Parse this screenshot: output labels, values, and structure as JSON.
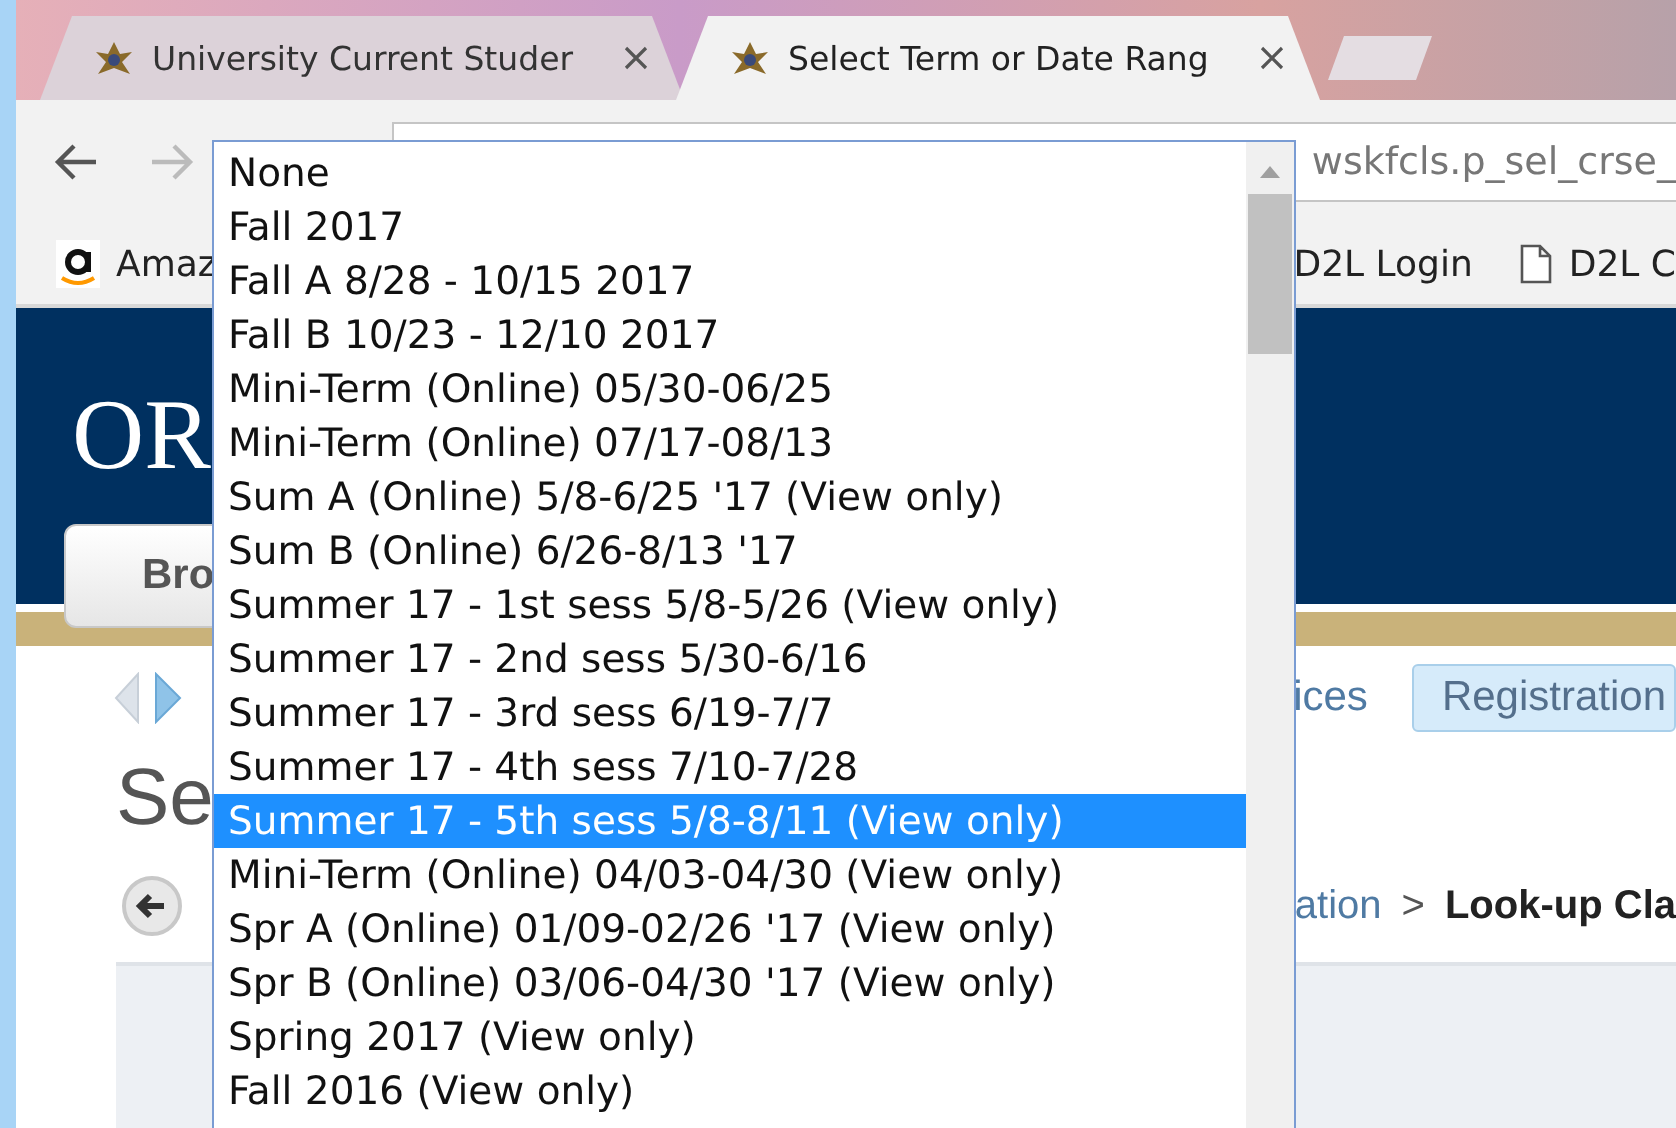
{
  "browser": {
    "tabs": [
      {
        "title": "University Current Studer",
        "selected": false
      },
      {
        "title": "Select Term or Date Rang",
        "selected": true
      }
    ],
    "address": "wskfcls.p_sel_crse_",
    "bookmarks": [
      {
        "label": "Amaz",
        "kind": "amazon"
      },
      {
        "label": "D2L Login",
        "kind": "plain"
      },
      {
        "label": "D2L C",
        "kind": "page"
      }
    ]
  },
  "page": {
    "logo": "OR",
    "button": "Bro",
    "nav": [
      {
        "label": "ices",
        "selected": false
      },
      {
        "label": "Registration",
        "selected": true
      }
    ],
    "title": "Se",
    "breadcrumb": [
      {
        "label": "ation",
        "current": false
      },
      {
        "label": ">",
        "current": false
      },
      {
        "label": "Look-up Cla",
        "current": true
      }
    ]
  },
  "dropdown": {
    "options": [
      {
        "label": "None",
        "selected": false
      },
      {
        "label": "Fall 2017",
        "selected": false
      },
      {
        "label": "Fall A 8/28 - 10/15 2017",
        "selected": false
      },
      {
        "label": "Fall B 10/23 - 12/10 2017",
        "selected": false
      },
      {
        "label": "Mini-Term (Online) 05/30-06/25",
        "selected": false
      },
      {
        "label": "Mini-Term (Online) 07/17-08/13",
        "selected": false
      },
      {
        "label": "Sum A (Online) 5/8-6/25 '17 (View only)",
        "selected": false
      },
      {
        "label": "Sum B (Online) 6/26-8/13 '17",
        "selected": false
      },
      {
        "label": "Summer 17 - 1st sess 5/8-5/26 (View only)",
        "selected": false
      },
      {
        "label": "Summer 17 - 2nd sess 5/30-6/16",
        "selected": false
      },
      {
        "label": "Summer 17 - 3rd sess 6/19-7/7",
        "selected": false
      },
      {
        "label": "Summer 17 - 4th sess 7/10-7/28",
        "selected": false
      },
      {
        "label": "Summer 17 - 5th sess 5/8-8/11 (View only)",
        "selected": true
      },
      {
        "label": "Mini-Term (Online) 04/03-04/30 (View only)",
        "selected": false
      },
      {
        "label": "Spr A (Online) 01/09-02/26 '17 (View only)",
        "selected": false
      },
      {
        "label": "Spr B (Online) 03/06-04/30 '17 (View only)",
        "selected": false
      },
      {
        "label": "Spring 2017 (View only)",
        "selected": false
      },
      {
        "label": "Fall 2016 (View only)",
        "selected": false
      }
    ]
  }
}
